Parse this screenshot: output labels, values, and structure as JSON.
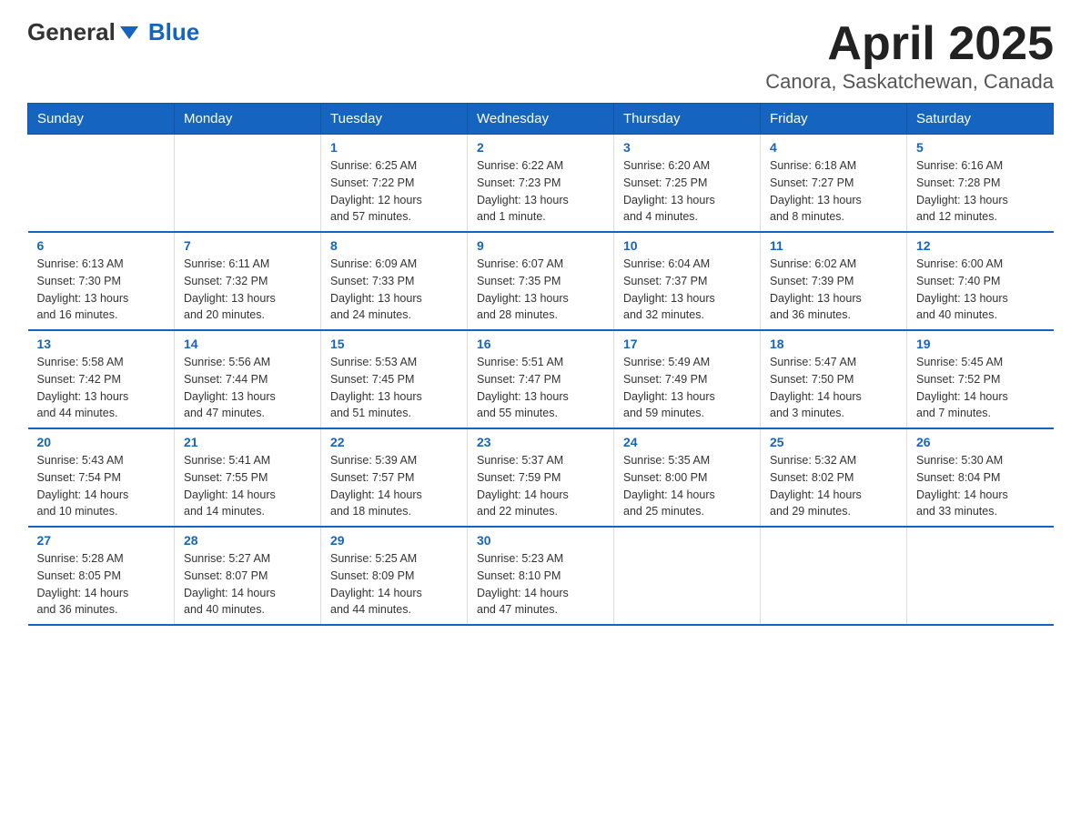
{
  "header": {
    "logo_general": "General",
    "logo_blue": "Blue",
    "title": "April 2025",
    "subtitle": "Canora, Saskatchewan, Canada"
  },
  "days_of_week": [
    "Sunday",
    "Monday",
    "Tuesday",
    "Wednesday",
    "Thursday",
    "Friday",
    "Saturday"
  ],
  "weeks": [
    [
      {
        "day": "",
        "info": ""
      },
      {
        "day": "",
        "info": ""
      },
      {
        "day": "1",
        "info": "Sunrise: 6:25 AM\nSunset: 7:22 PM\nDaylight: 12 hours\nand 57 minutes."
      },
      {
        "day": "2",
        "info": "Sunrise: 6:22 AM\nSunset: 7:23 PM\nDaylight: 13 hours\nand 1 minute."
      },
      {
        "day": "3",
        "info": "Sunrise: 6:20 AM\nSunset: 7:25 PM\nDaylight: 13 hours\nand 4 minutes."
      },
      {
        "day": "4",
        "info": "Sunrise: 6:18 AM\nSunset: 7:27 PM\nDaylight: 13 hours\nand 8 minutes."
      },
      {
        "day": "5",
        "info": "Sunrise: 6:16 AM\nSunset: 7:28 PM\nDaylight: 13 hours\nand 12 minutes."
      }
    ],
    [
      {
        "day": "6",
        "info": "Sunrise: 6:13 AM\nSunset: 7:30 PM\nDaylight: 13 hours\nand 16 minutes."
      },
      {
        "day": "7",
        "info": "Sunrise: 6:11 AM\nSunset: 7:32 PM\nDaylight: 13 hours\nand 20 minutes."
      },
      {
        "day": "8",
        "info": "Sunrise: 6:09 AM\nSunset: 7:33 PM\nDaylight: 13 hours\nand 24 minutes."
      },
      {
        "day": "9",
        "info": "Sunrise: 6:07 AM\nSunset: 7:35 PM\nDaylight: 13 hours\nand 28 minutes."
      },
      {
        "day": "10",
        "info": "Sunrise: 6:04 AM\nSunset: 7:37 PM\nDaylight: 13 hours\nand 32 minutes."
      },
      {
        "day": "11",
        "info": "Sunrise: 6:02 AM\nSunset: 7:39 PM\nDaylight: 13 hours\nand 36 minutes."
      },
      {
        "day": "12",
        "info": "Sunrise: 6:00 AM\nSunset: 7:40 PM\nDaylight: 13 hours\nand 40 minutes."
      }
    ],
    [
      {
        "day": "13",
        "info": "Sunrise: 5:58 AM\nSunset: 7:42 PM\nDaylight: 13 hours\nand 44 minutes."
      },
      {
        "day": "14",
        "info": "Sunrise: 5:56 AM\nSunset: 7:44 PM\nDaylight: 13 hours\nand 47 minutes."
      },
      {
        "day": "15",
        "info": "Sunrise: 5:53 AM\nSunset: 7:45 PM\nDaylight: 13 hours\nand 51 minutes."
      },
      {
        "day": "16",
        "info": "Sunrise: 5:51 AM\nSunset: 7:47 PM\nDaylight: 13 hours\nand 55 minutes."
      },
      {
        "day": "17",
        "info": "Sunrise: 5:49 AM\nSunset: 7:49 PM\nDaylight: 13 hours\nand 59 minutes."
      },
      {
        "day": "18",
        "info": "Sunrise: 5:47 AM\nSunset: 7:50 PM\nDaylight: 14 hours\nand 3 minutes."
      },
      {
        "day": "19",
        "info": "Sunrise: 5:45 AM\nSunset: 7:52 PM\nDaylight: 14 hours\nand 7 minutes."
      }
    ],
    [
      {
        "day": "20",
        "info": "Sunrise: 5:43 AM\nSunset: 7:54 PM\nDaylight: 14 hours\nand 10 minutes."
      },
      {
        "day": "21",
        "info": "Sunrise: 5:41 AM\nSunset: 7:55 PM\nDaylight: 14 hours\nand 14 minutes."
      },
      {
        "day": "22",
        "info": "Sunrise: 5:39 AM\nSunset: 7:57 PM\nDaylight: 14 hours\nand 18 minutes."
      },
      {
        "day": "23",
        "info": "Sunrise: 5:37 AM\nSunset: 7:59 PM\nDaylight: 14 hours\nand 22 minutes."
      },
      {
        "day": "24",
        "info": "Sunrise: 5:35 AM\nSunset: 8:00 PM\nDaylight: 14 hours\nand 25 minutes."
      },
      {
        "day": "25",
        "info": "Sunrise: 5:32 AM\nSunset: 8:02 PM\nDaylight: 14 hours\nand 29 minutes."
      },
      {
        "day": "26",
        "info": "Sunrise: 5:30 AM\nSunset: 8:04 PM\nDaylight: 14 hours\nand 33 minutes."
      }
    ],
    [
      {
        "day": "27",
        "info": "Sunrise: 5:28 AM\nSunset: 8:05 PM\nDaylight: 14 hours\nand 36 minutes."
      },
      {
        "day": "28",
        "info": "Sunrise: 5:27 AM\nSunset: 8:07 PM\nDaylight: 14 hours\nand 40 minutes."
      },
      {
        "day": "29",
        "info": "Sunrise: 5:25 AM\nSunset: 8:09 PM\nDaylight: 14 hours\nand 44 minutes."
      },
      {
        "day": "30",
        "info": "Sunrise: 5:23 AM\nSunset: 8:10 PM\nDaylight: 14 hours\nand 47 minutes."
      },
      {
        "day": "",
        "info": ""
      },
      {
        "day": "",
        "info": ""
      },
      {
        "day": "",
        "info": ""
      }
    ]
  ]
}
